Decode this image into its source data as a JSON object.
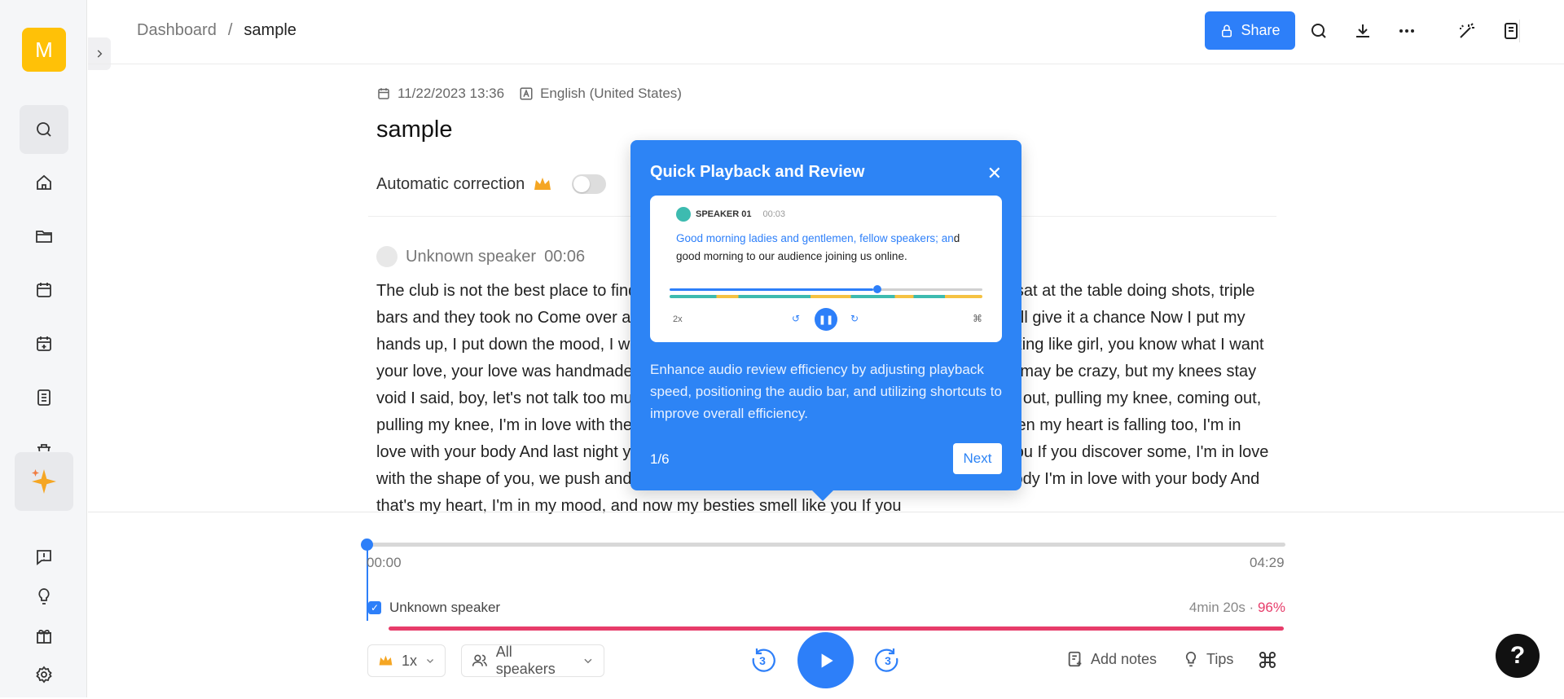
{
  "sidebar": {
    "avatar_letter": "M",
    "items": [
      "search",
      "home",
      "folder",
      "calendar",
      "calendar-plus",
      "document",
      "trash",
      "ai-sparkle",
      "feedback",
      "idea",
      "gift",
      "settings"
    ]
  },
  "header": {
    "breadcrumb_root": "Dashboard",
    "breadcrumb_sep": "/",
    "breadcrumb_current": "sample",
    "share_label": "Share"
  },
  "document": {
    "datetime": "11/22/2023 13:36",
    "language": "English (United States)",
    "title": "sample",
    "auto_correction_label": "Automatic correction",
    "speaker_name": "Unknown speaker",
    "speaker_time": "00:06",
    "transcript": "The club is not the best place to find a lover, so the bar is where I go. Me and my friends sat at the table doing shots, triple bars and they took no Come over and start up a conversation with just me and trust me, I'll give it a chance Now I put my hands up, I put down the mood, I was taking on the dance floor, jumped in and I was thinking like girl, you know what I want your love, your love was handmade for somebody like me Coming out, pulling my knee, I may be crazy, but my knees stay void I said, boy, let's not talk too much grab on my waist and put that body on me Coming out, pulling my knee, coming out, pulling my knee, I'm in love with the shape of you, we push and pull like a magnet But when my heart is falling too, I'm in love with your body And last night you were in my mood, and now my besties smell like you If you discover some, I'm in love with the shape of you, we push and pull, I'm in love with your body I'm in love with your body I'm in love with your body And that's my heart, I'm in my mood, and now my besties smell like you If you"
  },
  "popup": {
    "title": "Quick Playback and Review",
    "card_speaker": "SPEAKER 01",
    "card_time": "00:03",
    "card_text_highlight": "Good morning ladies and gentlemen, fellow speakers; an",
    "card_text_rest": "d good morning to our audience joining us online.",
    "card_speed": "2x",
    "description": "Enhance audio review efficiency by adjusting playback speed, positioning the audio bar, and utilizing shortcuts to improve overall efficiency.",
    "step": "1/6",
    "next_label": "Next"
  },
  "player": {
    "time_start": "00:00",
    "time_end": "04:29",
    "progress": 0,
    "speaker_label": "Unknown speaker",
    "speaker_duration": "4min 20s ·",
    "speaker_percent": "96%",
    "speed_label": "1x",
    "speakers_filter": "All speakers",
    "skip_seconds": "3",
    "add_notes_label": "Add notes",
    "tips_label": "Tips",
    "help_label": "?"
  },
  "colors": {
    "accent": "#2d7ff9",
    "speaker_bar": "#e73c6a",
    "avatar": "#ffc107"
  }
}
